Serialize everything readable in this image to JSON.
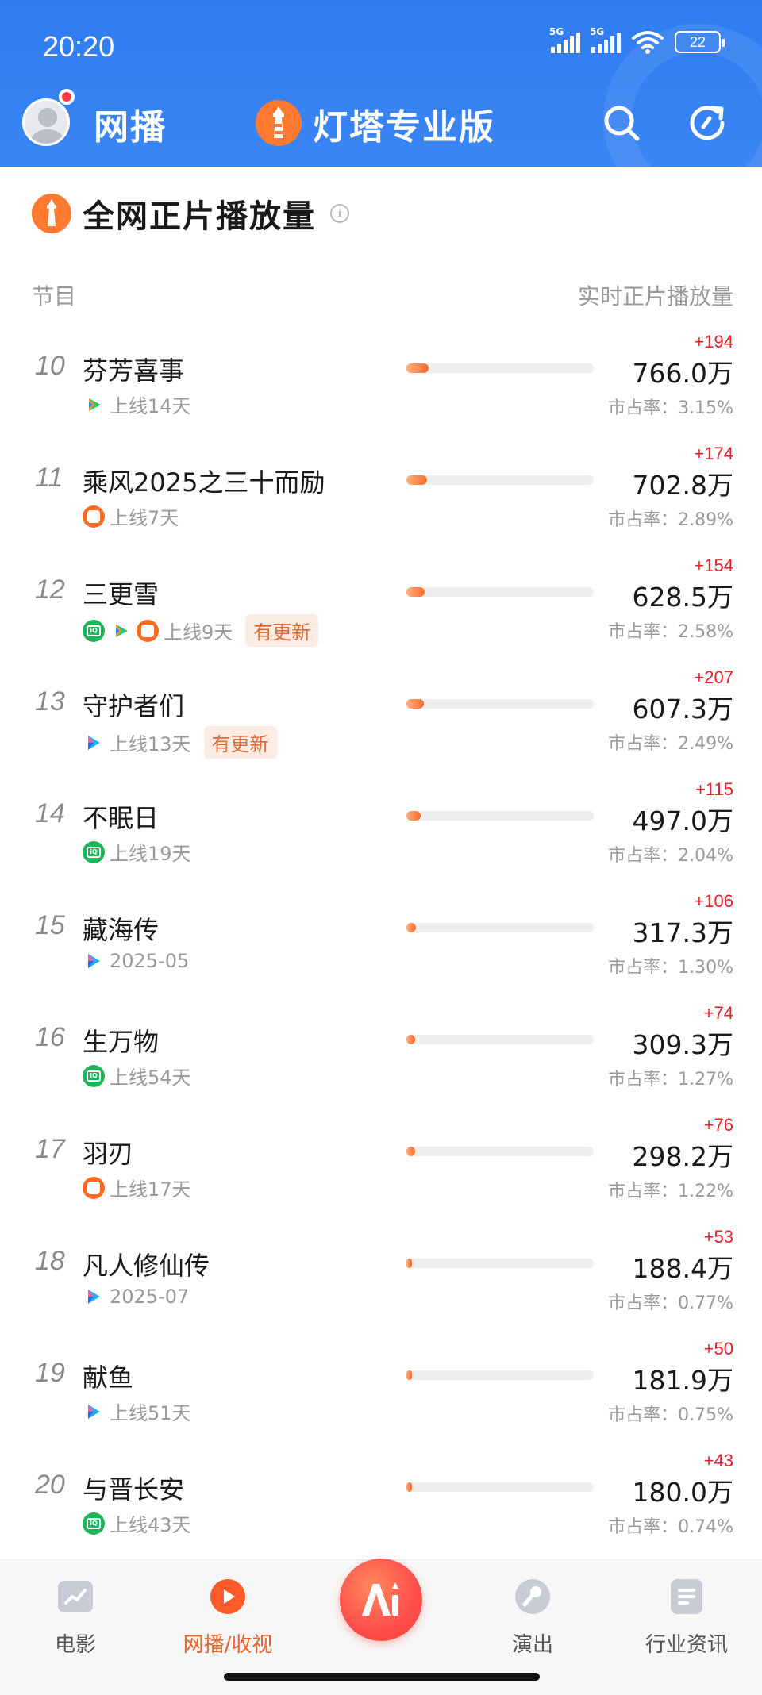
{
  "status_bar": {
    "time": "20:20",
    "net1": "5G",
    "net2": "5G",
    "battery": "22"
  },
  "header": {
    "left_brand": "网播",
    "center_brand": "灯塔专业版",
    "icons": [
      "avatar",
      "notification-dot",
      "lighthouse-logo-icon",
      "search-icon",
      "refresh-icon"
    ],
    "colors": {
      "background": "#2f7cf0",
      "accent": "#ff6a2a"
    }
  },
  "section": {
    "title": "全网正片播放量",
    "col_left": "节目",
    "col_right": "实时正片播放量"
  },
  "rows": [
    {
      "rank": "10",
      "title": "芬芳喜事",
      "platforms": [
        "tencent"
      ],
      "meta": "上线14天",
      "update": "",
      "delta": "+194",
      "value": "766.0万",
      "share": "市占率：3.15%",
      "share_pct": 3.15
    },
    {
      "rank": "11",
      "title": "乘风2025之三十而励",
      "platforms": [
        "mango"
      ],
      "meta": "上线7天",
      "update": "",
      "delta": "+174",
      "value": "702.8万",
      "share": "市占率：2.89%",
      "share_pct": 2.89
    },
    {
      "rank": "12",
      "title": "三更雪",
      "platforms": [
        "iqiyi",
        "tencent",
        "mango"
      ],
      "meta": "上线9天",
      "update": "有更新",
      "delta": "+154",
      "value": "628.5万",
      "share": "市占率：2.58%",
      "share_pct": 2.58
    },
    {
      "rank": "13",
      "title": "守护者们",
      "platforms": [
        "youku"
      ],
      "meta": "上线13天",
      "update": "有更新",
      "delta": "+207",
      "value": "607.3万",
      "share": "市占率：2.49%",
      "share_pct": 2.49
    },
    {
      "rank": "14",
      "title": "不眠日",
      "platforms": [
        "iqiyi"
      ],
      "meta": "上线19天",
      "update": "",
      "delta": "+115",
      "value": "497.0万",
      "share": "市占率：2.04%",
      "share_pct": 2.04
    },
    {
      "rank": "15",
      "title": "藏海传",
      "platforms": [
        "youku"
      ],
      "meta": "2025-05",
      "update": "",
      "delta": "+106",
      "value": "317.3万",
      "share": "市占率：1.30%",
      "share_pct": 1.3
    },
    {
      "rank": "16",
      "title": "生万物",
      "platforms": [
        "iqiyi"
      ],
      "meta": "上线54天",
      "update": "",
      "delta": "+74",
      "value": "309.3万",
      "share": "市占率：1.27%",
      "share_pct": 1.27
    },
    {
      "rank": "17",
      "title": "羽刃",
      "platforms": [
        "mango"
      ],
      "meta": "上线17天",
      "update": "",
      "delta": "+76",
      "value": "298.2万",
      "share": "市占率：1.22%",
      "share_pct": 1.22
    },
    {
      "rank": "18",
      "title": "凡人修仙传",
      "platforms": [
        "youku"
      ],
      "meta": "2025-07",
      "update": "",
      "delta": "+53",
      "value": "188.4万",
      "share": "市占率：0.77%",
      "share_pct": 0.77
    },
    {
      "rank": "19",
      "title": "献鱼",
      "platforms": [
        "youku"
      ],
      "meta": "上线51天",
      "update": "",
      "delta": "+50",
      "value": "181.9万",
      "share": "市占率：0.75%",
      "share_pct": 0.75
    },
    {
      "rank": "20",
      "title": "与晋长安",
      "platforms": [
        "iqiyi"
      ],
      "meta": "上线43天",
      "update": "",
      "delta": "+43",
      "value": "180.0万",
      "share": "市占率：0.74%",
      "share_pct": 0.74
    }
  ],
  "bottom_nav": {
    "items": [
      {
        "label": "电影",
        "icon": "film-icon",
        "active": false
      },
      {
        "label": "网播/收视",
        "icon": "play-icon",
        "active": true
      },
      {
        "label": "",
        "icon": "ai-icon",
        "active": false
      },
      {
        "label": "演出",
        "icon": "microphone-icon",
        "active": false
      },
      {
        "label": "行业资讯",
        "icon": "document-icon",
        "active": false
      }
    ]
  }
}
